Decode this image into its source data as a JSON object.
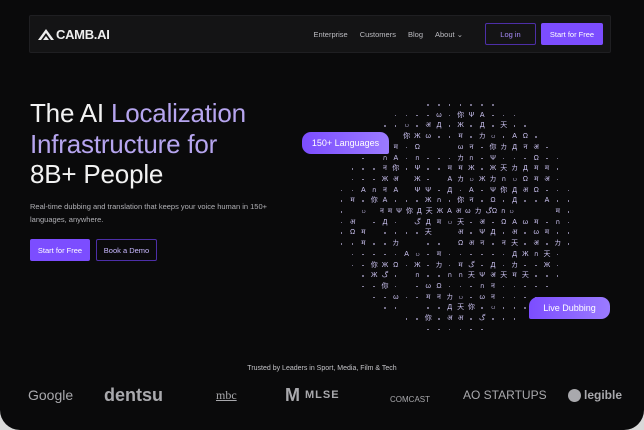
{
  "nav": {
    "brand": "CAMB.AI",
    "links": [
      "Enterprise",
      "Customers",
      "Blog",
      "About"
    ],
    "login": "Log in",
    "start": "Start for Free"
  },
  "hero": {
    "title_white": "The AI ",
    "title_accent1": "Localization",
    "title_accent2": "Infrastructure for",
    "title_line3": "8B+ People",
    "subtitle": "Real-time dubbing and translation that keeps your voice human in 150+ languages, anywhere.",
    "cta_primary": "Start for Free",
    "cta_secondary": "Book a Demo"
  },
  "globe": {
    "glyphs": "नमΨ你Д天ЖAअωカگΩกပ",
    "badge_languages": "150+ Languages",
    "badge_dubbing": "Live Dubbing"
  },
  "trusted": {
    "label": "Trusted by Leaders in Sport, Media, Film & Tech",
    "logos": [
      "Google",
      "dentsu",
      "mbc",
      "MLSE",
      "COMCAST",
      "AO STARTUPS",
      "legible"
    ]
  },
  "colors": {
    "accent": "#7c4dff",
    "background": "#0a0a0b"
  }
}
